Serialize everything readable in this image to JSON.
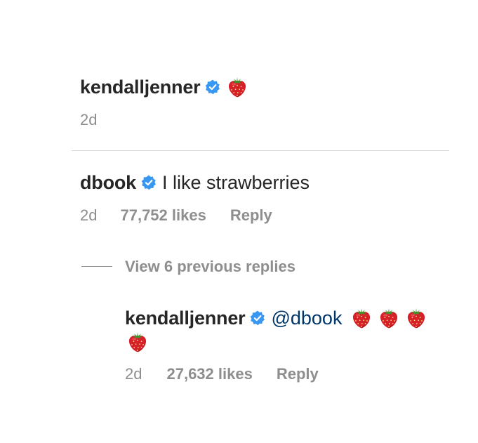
{
  "caption": {
    "username": "kendalljenner",
    "time": "2d",
    "emoji_icon": "strawberry-icon"
  },
  "comment": {
    "username": "dbook",
    "text": "I like strawberries",
    "time": "2d",
    "likes": "77,752 likes",
    "reply_label": "Reply"
  },
  "view_replies_label": "View 6 previous replies",
  "reply": {
    "username": "kendalljenner",
    "mention": "@dbook",
    "time": "2d",
    "likes": "27,632 likes",
    "reply_label": "Reply",
    "emoji_icon": "strawberry-icon"
  },
  "colors": {
    "verified_badge": "#3897f0",
    "mention": "#00376b",
    "meta": "#8e8e8e",
    "divider": "#dbdbdb"
  }
}
